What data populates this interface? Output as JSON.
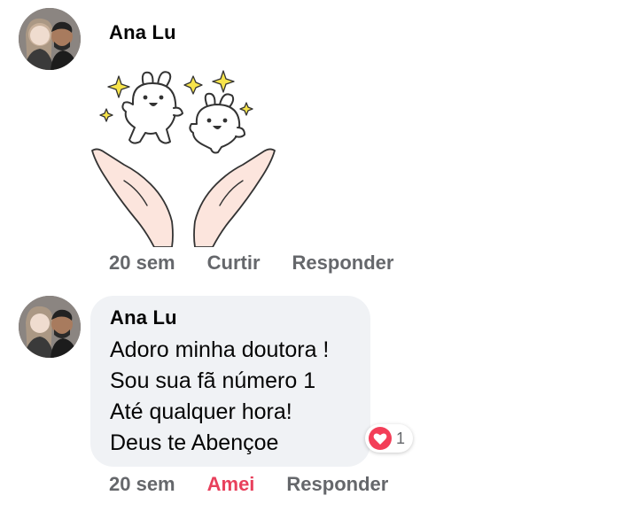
{
  "comments": [
    {
      "author": "Ana Lu",
      "kind": "sticker",
      "sticker_icon": "bunnies-hands-sparkles-sticker",
      "time": "20 sem",
      "like_label": "Curtir",
      "reply_label": "Responder"
    },
    {
      "author": "Ana Lu",
      "kind": "text",
      "text": "Adoro minha doutora !\nSou sua fã número 1\nAté qualquer hora!\nDeus te Abençoe",
      "reaction": {
        "icon": "heart-icon",
        "count": "1",
        "color": "#f33e58"
      },
      "time": "20 sem",
      "like_label": "Amei",
      "like_color": "#e8405c",
      "reply_label": "Responder"
    }
  ],
  "colors": {
    "meta_text": "#65676b",
    "bubble_bg": "#f0f2f5",
    "sparkle": "#f7e44b",
    "hand_fill": "#fce5dd"
  }
}
